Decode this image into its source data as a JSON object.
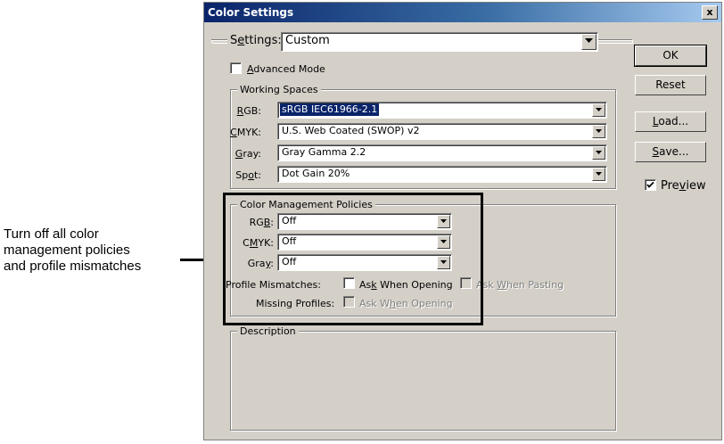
{
  "callout": {
    "lines": [
      "Turn off all color",
      "management policies",
      "and profile mismatches"
    ]
  },
  "dialog": {
    "title": "Color Settings",
    "close_glyph": "x",
    "settings": {
      "label": "Settings:",
      "_u": 1,
      "value": "Custom"
    },
    "advanced_mode": {
      "label": "Advanced Mode",
      "_u": 0,
      "checked": false
    },
    "working_spaces": {
      "legend": "Working Spaces",
      "rows": [
        {
          "label": "RGB:",
          "_u": 0,
          "value": "sRGB IEC61966-2.1",
          "selected": true
        },
        {
          "label": "CMYK:",
          "_u": 0,
          "value": "U.S. Web Coated (SWOP) v2"
        },
        {
          "label": "Gray:",
          "_u": 0,
          "value": "Gray Gamma 2.2"
        },
        {
          "label": "Spot:",
          "_u": 2,
          "value": "Dot Gain 20%"
        }
      ]
    },
    "policies": {
      "legend": "Color Management Policies",
      "rows": [
        {
          "label": "RGB:",
          "_u": 2,
          "value": "Off"
        },
        {
          "label": "CMYK:",
          "_u": 1,
          "value": "Off"
        },
        {
          "label": "Gray:",
          "_u": 3,
          "value": "Off"
        }
      ],
      "profile_mismatches": {
        "label": "Profile Mismatches:",
        "ask_opening": "Ask When Opening",
        "ask_opening_u": 2,
        "ask_pasting": "Ask When Pasting",
        "ask_pasting_u": 4
      },
      "missing_profiles": {
        "label": "Missing Profiles:",
        "ask_opening": "Ask When Opening",
        "ask_opening_u": 5
      }
    },
    "description": {
      "legend": "Description"
    },
    "buttons": {
      "ok": "OK",
      "reset": "Reset",
      "load": "Load...",
      "load_u": 0,
      "save": "Save...",
      "save_u": 0
    },
    "preview": {
      "label": "Preview",
      "_u": 3,
      "checked": true
    }
  }
}
